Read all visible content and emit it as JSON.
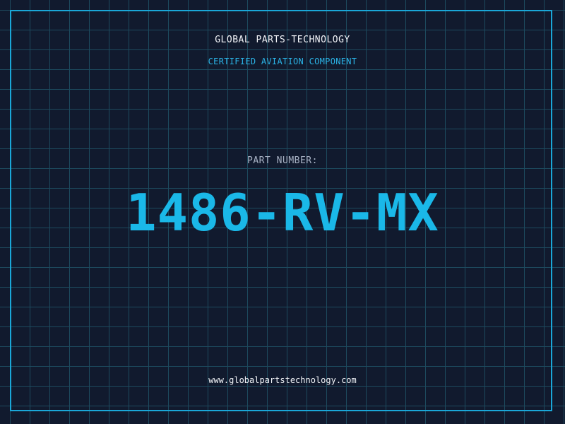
{
  "header": {
    "company": "GLOBAL PARTS-TECHNOLOGY",
    "subtitle": "CERTIFIED AVIATION COMPONENT"
  },
  "main": {
    "label": "PART NUMBER:",
    "part_number": "1486-RV-MX"
  },
  "footer": {
    "url": "www.globalpartstechnology.com"
  },
  "colors": {
    "background": "#111a2e",
    "grid": "#1d4a5e",
    "accent": "#1ab8e8",
    "text": "#f2f4f8"
  }
}
